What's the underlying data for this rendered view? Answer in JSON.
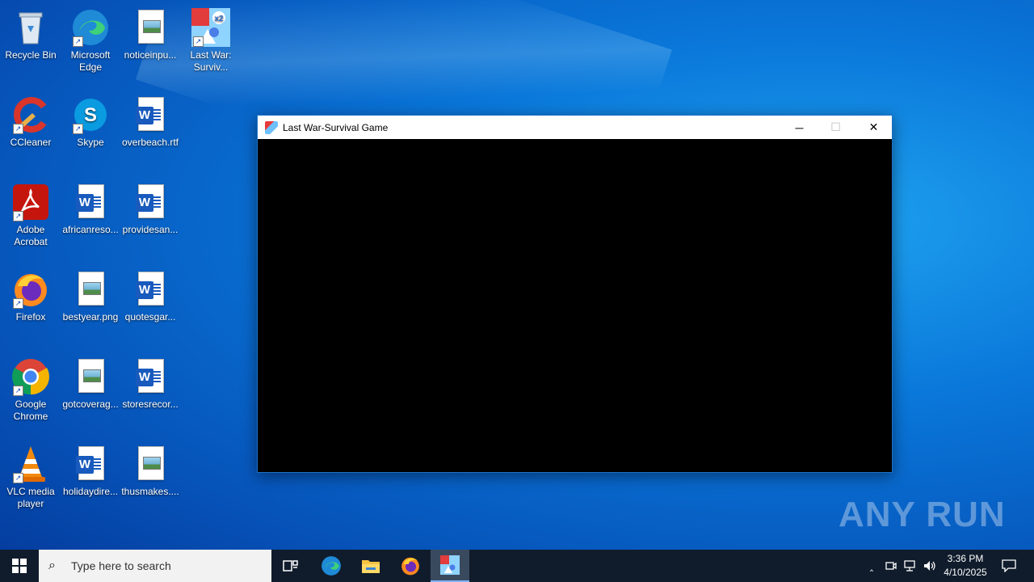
{
  "desktop": {
    "icons": [
      {
        "label": "Recycle Bin",
        "icon": "recycle-bin-icon"
      },
      {
        "label": "Microsoft Edge",
        "icon": "edge-icon"
      },
      {
        "label": "noticeinpu...",
        "icon": "image-file-icon"
      },
      {
        "label": "Last War: Surviv...",
        "icon": "last-war-icon"
      },
      {
        "label": "CCleaner",
        "icon": "ccleaner-icon"
      },
      {
        "label": "Skype",
        "icon": "skype-icon"
      },
      {
        "label": "overbeach.rtf",
        "icon": "word-doc-icon"
      },
      {
        "label": "Adobe Acrobat",
        "icon": "acrobat-icon"
      },
      {
        "label": "africanreso...",
        "icon": "word-doc-icon"
      },
      {
        "label": "providesan...",
        "icon": "word-doc-icon"
      },
      {
        "label": "Firefox",
        "icon": "firefox-icon"
      },
      {
        "label": "bestyear.png",
        "icon": "image-file-icon"
      },
      {
        "label": "quotesgar...",
        "icon": "word-doc-icon"
      },
      {
        "label": "Google Chrome",
        "icon": "chrome-icon"
      },
      {
        "label": "gotcoverag...",
        "icon": "image-file-icon"
      },
      {
        "label": "storesrecor...",
        "icon": "word-doc-icon"
      },
      {
        "label": "VLC media player",
        "icon": "vlc-icon"
      },
      {
        "label": "holidaydire...",
        "icon": "word-doc-icon"
      },
      {
        "label": "thusmakes....",
        "icon": "image-file-icon"
      }
    ]
  },
  "window": {
    "title": "Last War-Survival Game",
    "minimize_glyph": "─",
    "maximize_glyph": "☐",
    "close_glyph": "✕"
  },
  "watermark": {
    "text": "ANY RUN"
  },
  "taskbar": {
    "search_placeholder": "Type here to search",
    "time": "3:36 PM",
    "date": "4/10/2025",
    "colors": {
      "background": "#101c2c",
      "active_item": "#3a4a5e"
    }
  }
}
